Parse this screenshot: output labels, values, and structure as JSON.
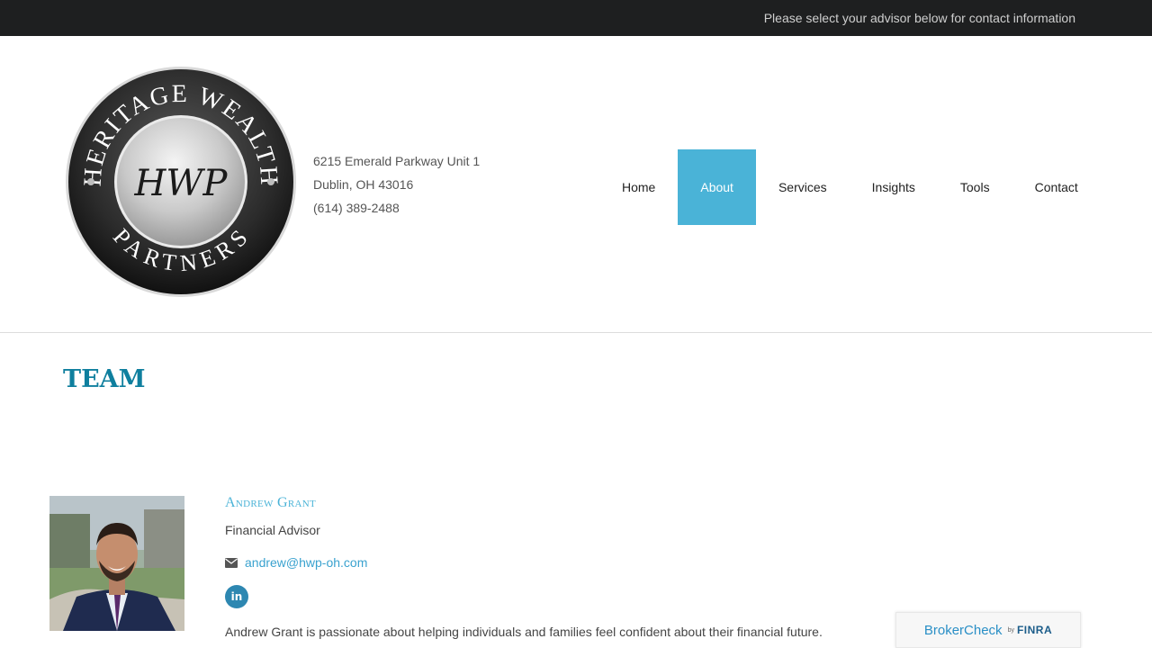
{
  "topbar": {
    "text": "Please select your advisor below for contact information"
  },
  "logo": {
    "top_text": "HERITAGE WEALTH",
    "bottom_text": "PARTNERS",
    "monogram": "HWP"
  },
  "address": {
    "line1": "6215 Emerald Parkway Unit 1",
    "line2": "Dublin, OH 43016",
    "phone": "(614) 389-2488"
  },
  "nav": {
    "items": [
      {
        "label": "Home"
      },
      {
        "label": "About"
      },
      {
        "label": "Services"
      },
      {
        "label": "Insights"
      },
      {
        "label": "Tools"
      },
      {
        "label": "Contact"
      }
    ],
    "active": "About"
  },
  "team": {
    "title": "TEAM"
  },
  "advisor": {
    "name": "Andrew Grant",
    "role": "Financial Advisor",
    "email": "andrew@hwp-oh.com",
    "linkedin_label": "in",
    "bio": "Andrew Grant is passionate about helping individuals and families feel confident about their financial future."
  },
  "brokercheck": {
    "brand": "BrokerCheck",
    "by": "by",
    "finra": "FINRA"
  },
  "colors": {
    "accent": "#4ab3d7",
    "title": "#0f7f9e",
    "topbar": "#1e1f20"
  }
}
